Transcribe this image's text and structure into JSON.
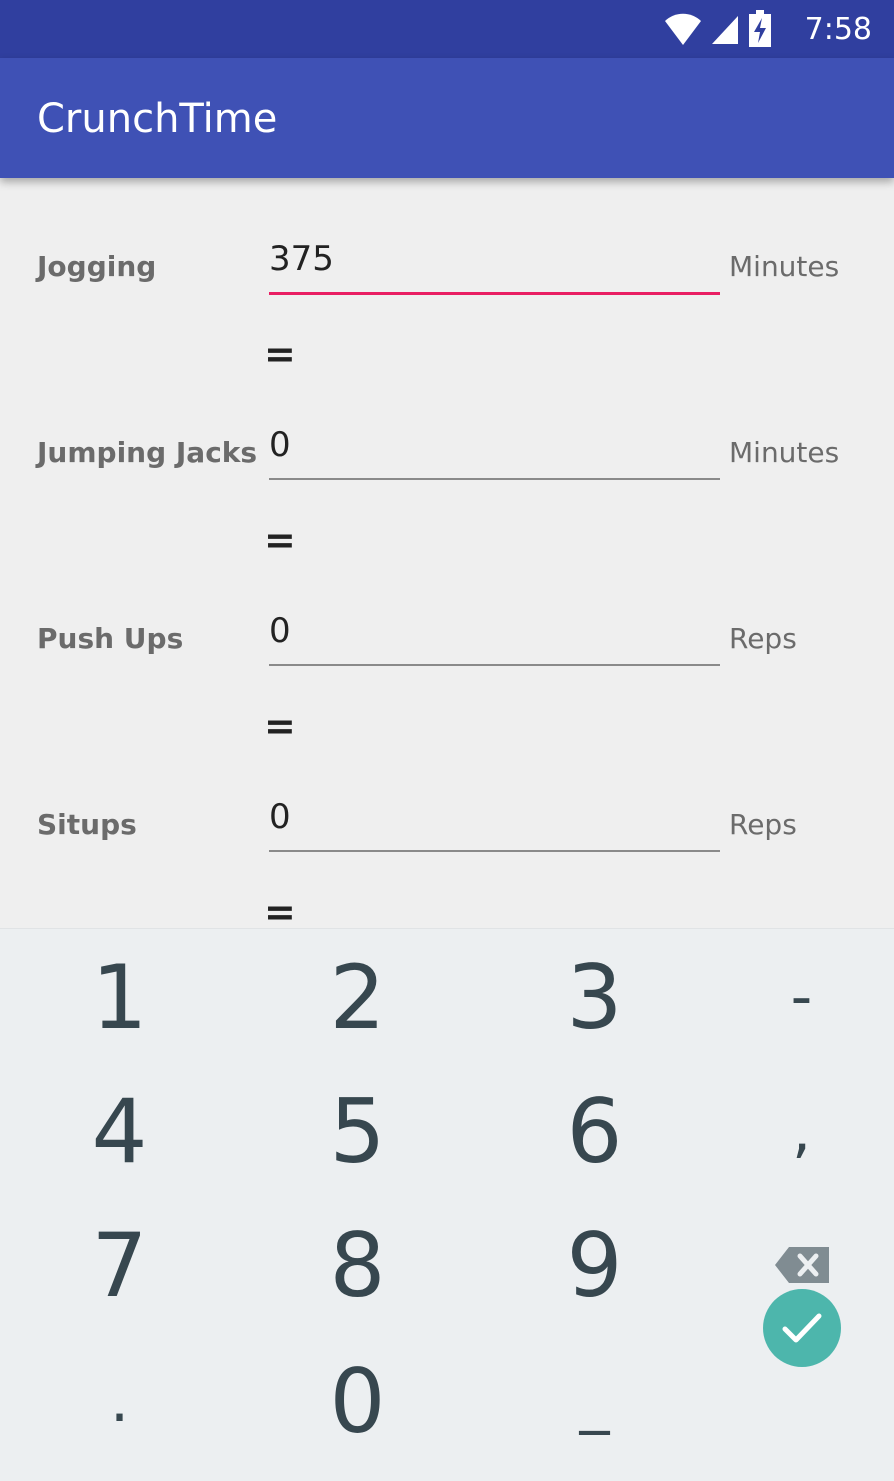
{
  "status_bar": {
    "time": "7:58"
  },
  "app": {
    "title": "CrunchTime"
  },
  "rows": [
    {
      "label": "Jogging",
      "value": "375",
      "unit": "Minutes"
    },
    {
      "label": "Jumping Jacks",
      "value": "0",
      "unit": "Minutes"
    },
    {
      "label": "Push Ups",
      "value": "0",
      "unit": "Reps"
    },
    {
      "label": "Situps",
      "value": "0",
      "unit": "Reps"
    }
  ],
  "equals": "=",
  "keyboard": {
    "row1": [
      "1",
      "2",
      "3",
      "-"
    ],
    "row2": [
      "4",
      "5",
      "6",
      ","
    ],
    "row3": [
      "7",
      "8",
      "9"
    ],
    "row4": [
      ".",
      "0",
      "_"
    ]
  },
  "icons": {
    "wifi": "wifi-icon",
    "signal": "cell-signal-icon",
    "battery": "battery-charging-icon",
    "backspace": "backspace-icon",
    "done": "check-icon"
  },
  "colors": {
    "status_bar": "#303f9f",
    "app_bar": "#3f51b5",
    "active_underline": "#e91e63",
    "done_button": "#4db6ac"
  }
}
